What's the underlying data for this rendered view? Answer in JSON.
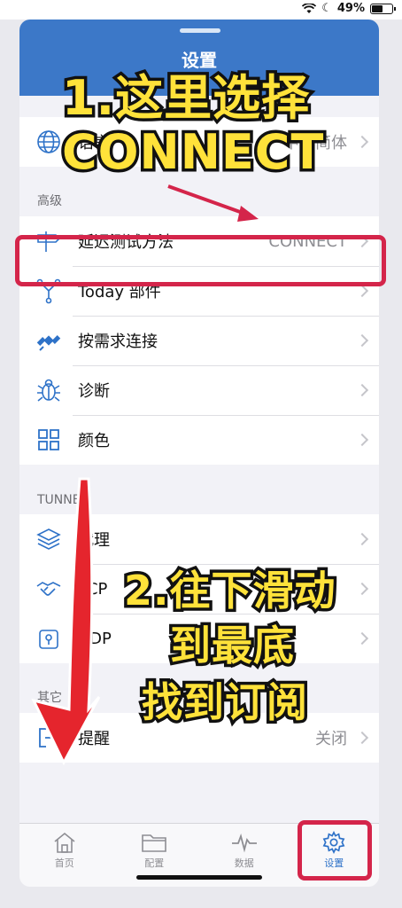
{
  "status_bar": {
    "battery_text": "49%",
    "battery_level": 0.49
  },
  "sheet_header": {
    "title": "设置"
  },
  "rows_top": [
    {
      "icon": "globe-icon",
      "label": "语言",
      "value": "中文简体"
    }
  ],
  "sections": {
    "advanced": "高级",
    "tunnel": "TUNNEL",
    "other": "其它"
  },
  "advanced_rows": [
    {
      "icon": "signpost-icon",
      "label": "延迟测试方法",
      "value": "CONNECT"
    },
    {
      "icon": "widget-icon",
      "label": "Today 部件",
      "value": ""
    },
    {
      "icon": "satellite-icon",
      "label": "按需求连接",
      "value": ""
    },
    {
      "icon": "bug-icon",
      "label": "诊断",
      "value": ""
    },
    {
      "icon": "grid-icon",
      "label": "颜色",
      "value": ""
    }
  ],
  "tunnel_rows": [
    {
      "icon": "layers-icon",
      "label": "代理",
      "value": ""
    },
    {
      "icon": "handshake-icon",
      "label": "TCP",
      "value": ""
    },
    {
      "icon": "lock-icon",
      "label": "UDP",
      "value": ""
    }
  ],
  "other_rows": [
    {
      "icon": "exit-icon",
      "label": "提醒",
      "value": "关闭"
    }
  ],
  "tabs": [
    {
      "icon": "home-icon",
      "label": "首页"
    },
    {
      "icon": "folder-icon",
      "label": "配置"
    },
    {
      "icon": "pulse-icon",
      "label": "数据"
    },
    {
      "icon": "gear-icon",
      "label": "设置",
      "active": true
    }
  ],
  "overlays": {
    "step1_line1": "1.这里选择",
    "step1_line2": "CONNECT",
    "step2_line1": "2.往下滑动",
    "step2_line2": "到最底",
    "step2_line3": "找到订阅"
  },
  "colors": {
    "accent": "#2e72c8",
    "highlight": "#d4254a",
    "callout": "#ffe23a"
  }
}
